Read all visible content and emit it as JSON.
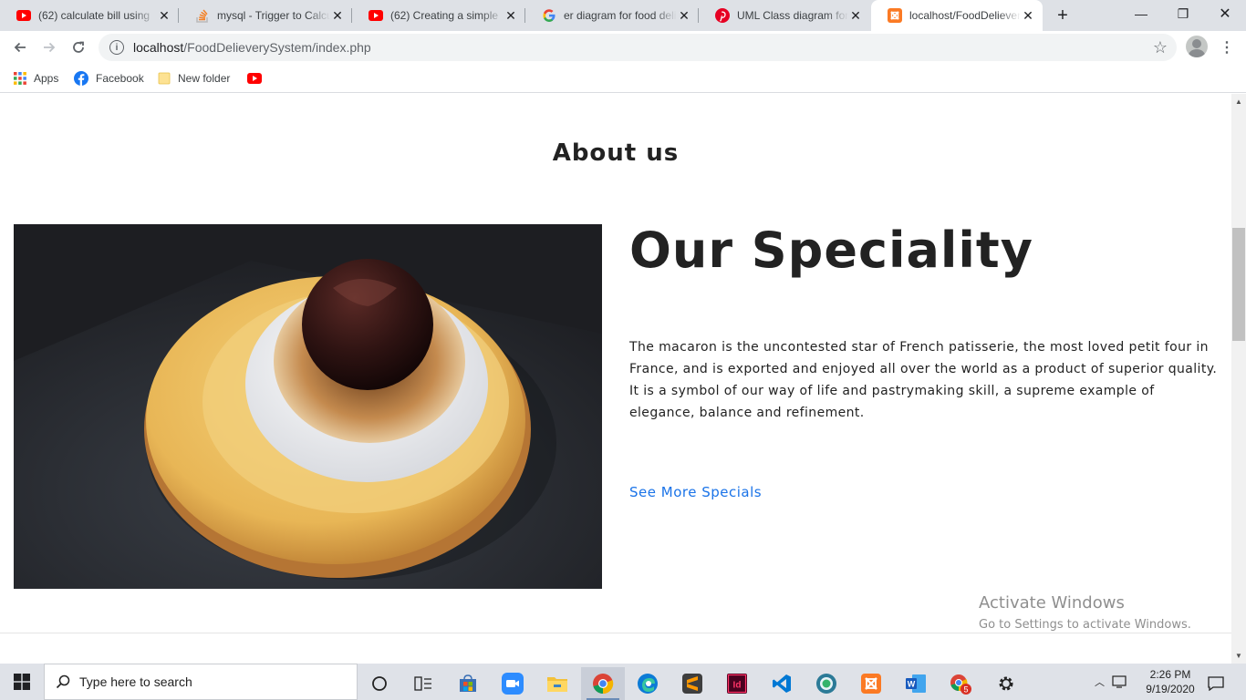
{
  "browser": {
    "tabs": [
      {
        "title": "(62) calculate bill using",
        "icon": "youtube-icon"
      },
      {
        "title": "mysql - Trigger to Calcu",
        "icon": "stackoverflow-icon"
      },
      {
        "title": "(62) Creating a simple",
        "icon": "youtube-icon"
      },
      {
        "title": "er diagram for food deli",
        "icon": "google-icon"
      },
      {
        "title": "UML Class diagram for",
        "icon": "pinterest-icon"
      },
      {
        "title": "localhost/FoodDeliever",
        "icon": "xampp-icon",
        "active": true
      }
    ],
    "url_host": "localhost",
    "url_path": "/FoodDelieverySystem/index.php",
    "bookmarks": [
      "Apps",
      "Facebook",
      "New folder"
    ]
  },
  "page": {
    "about_title": "About us",
    "speciality_heading": "Our Speciality",
    "speciality_text": "The macaron is the uncontested star of French patisserie, the most loved petit four in France, and is exported and enjoyed all over the world as a product of superior quality. It is a symbol of our way of life and pastrymaking skill, a supreme example of elegance, balance and refinement.",
    "see_more_label": "See More Specials",
    "activate_windows": {
      "title": "Activate Windows",
      "subtitle": "Go to Settings to activate Windows."
    }
  },
  "taskbar": {
    "search_placeholder": "Type here to search",
    "time": "2:26 PM",
    "date": "9/19/2020",
    "badge_count": "5"
  },
  "colors": {
    "link": "#1a73e8",
    "youtube": "#ff0000",
    "taskbar": "#dfe2e8"
  }
}
